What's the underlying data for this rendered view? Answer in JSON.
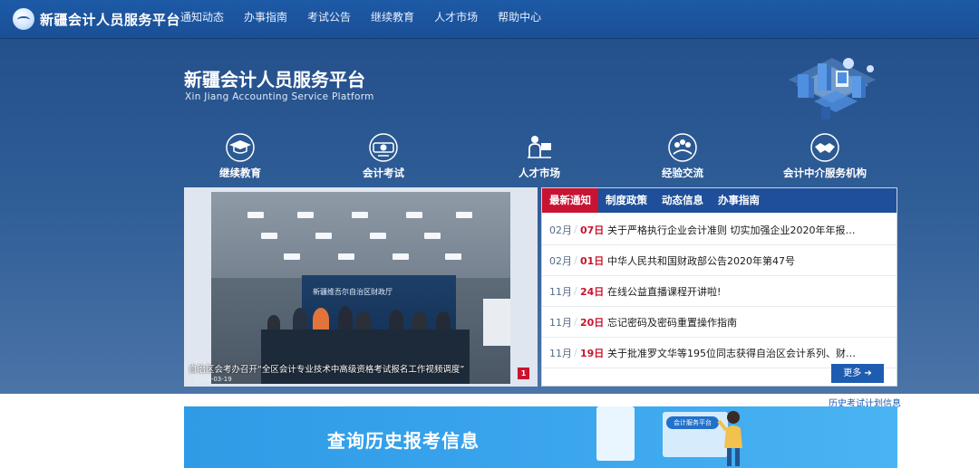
{
  "brand": {
    "name": "新疆会计人员服务平台"
  },
  "nav": {
    "items": [
      {
        "label": "通知动态"
      },
      {
        "label": "办事指南"
      },
      {
        "label": "考试公告"
      },
      {
        "label": "继续教育"
      },
      {
        "label": "人才市场"
      },
      {
        "label": "帮助中心"
      }
    ]
  },
  "hero": {
    "title": "新疆会计人员服务平台",
    "subtitle": "Xin Jiang Accounting Service Platform",
    "shortcuts": [
      {
        "label": "继续教育",
        "icon": "graduation-cap-icon"
      },
      {
        "label": "会计考试",
        "icon": "exam-icon"
      },
      {
        "label": "人才市场",
        "icon": "talent-market-icon"
      },
      {
        "label": "经验交流",
        "icon": "discussion-icon"
      },
      {
        "label": "会计中介服务机构",
        "icon": "handshake-icon"
      }
    ]
  },
  "carousel": {
    "screen_text": "新疆维吾尔自治区财政厅",
    "caption": "自治区会考办召开“全区会计专业技术中高级资格考试报名工作视频调度”",
    "date": "2020-03-19",
    "page": "1"
  },
  "news": {
    "tabs": [
      {
        "label": "最新通知"
      },
      {
        "label": "制度政策"
      },
      {
        "label": "动态信息"
      },
      {
        "label": "办事指南"
      }
    ],
    "items": [
      {
        "month": "02月",
        "day": "07日",
        "title": "关于严格执行企业会计准则 切实加强企业2020年年报…"
      },
      {
        "month": "02月",
        "day": "01日",
        "title": "中华人民共和国财政部公告2020年第47号"
      },
      {
        "month": "11月",
        "day": "24日",
        "title": "在线公益直播课程开讲啦!"
      },
      {
        "month": "11月",
        "day": "20日",
        "title": "忘记密码及密码重置操作指南"
      },
      {
        "month": "11月",
        "day": "19日",
        "title": "关于批准罗文华等195位同志获得自治区会计系列、财…"
      }
    ],
    "more_label": "更多 ➔"
  },
  "lower": {
    "history_link": "历史考试计划信息",
    "banner_title": "查询历史报考信息",
    "banner_chip": "会计服务平台"
  },
  "colors": {
    "nav_bg": "#1d5aa6",
    "tab_active": "#c81432",
    "tab_bar": "#1f4f9a",
    "date_red": "#c8142d",
    "banner_blue": "#3ba6ee"
  }
}
